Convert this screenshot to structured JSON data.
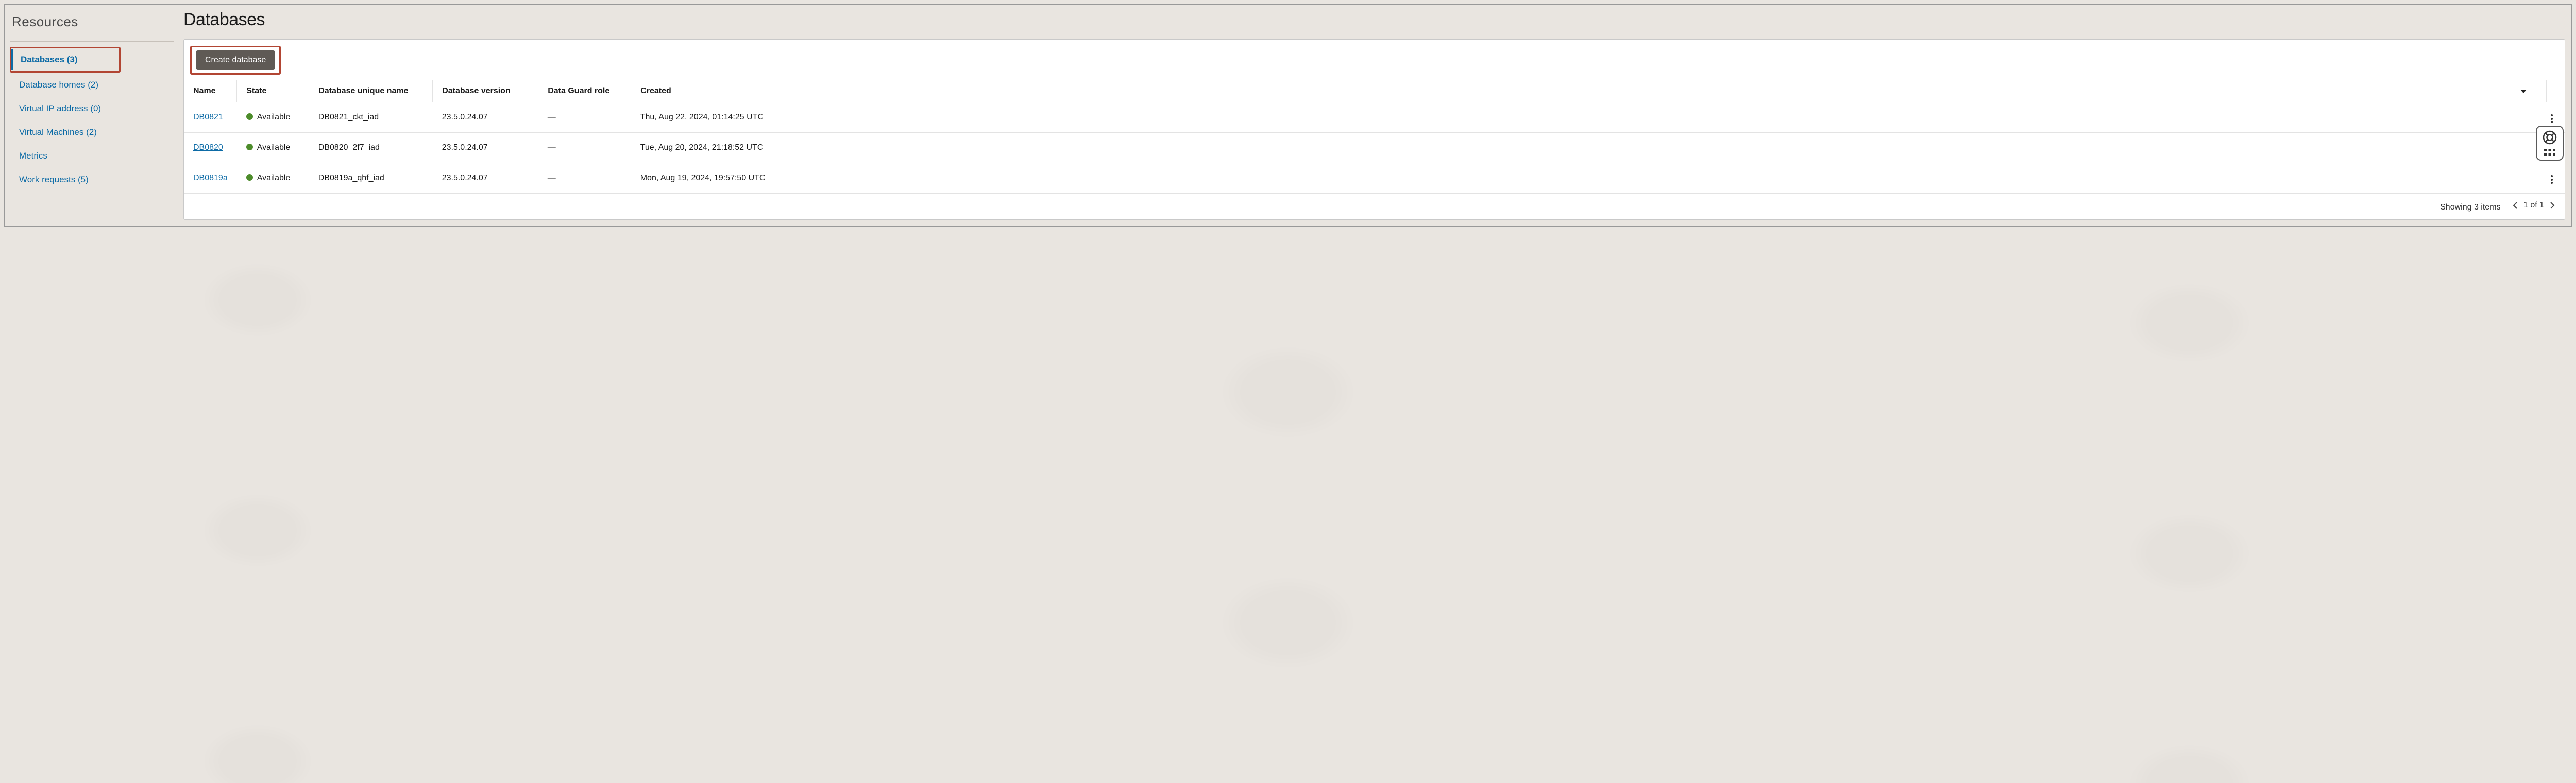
{
  "sidebar": {
    "title": "Resources",
    "items": [
      {
        "label": "Databases (3)",
        "active": true,
        "highlighted": true
      },
      {
        "label": "Database homes (2)",
        "active": false
      },
      {
        "label": "Virtual IP address (0)",
        "active": false
      },
      {
        "label": "Virtual Machines (2)",
        "active": false
      },
      {
        "label": "Metrics",
        "active": false
      },
      {
        "label": "Work requests (5)",
        "active": false
      }
    ]
  },
  "main": {
    "title": "Databases",
    "create_button": "Create database",
    "columns": {
      "name": "Name",
      "state": "State",
      "unique_name": "Database unique name",
      "version": "Database version",
      "dg_role": "Data Guard role",
      "created": "Created"
    },
    "rows": [
      {
        "name": "DB0821",
        "state": "Available",
        "status_color": "#4d8c2b",
        "unique_name": "DB0821_ckt_iad",
        "version": "23.5.0.24.07",
        "dg_role": "—",
        "created": "Thu, Aug 22, 2024, 01:14:25 UTC"
      },
      {
        "name": "DB0820",
        "state": "Available",
        "status_color": "#4d8c2b",
        "unique_name": "DB0820_2f7_iad",
        "version": "23.5.0.24.07",
        "dg_role": "—",
        "created": "Tue, Aug 20, 2024, 21:18:52 UTC"
      },
      {
        "name": "DB0819a",
        "state": "Available",
        "status_color": "#4d8c2b",
        "unique_name": "DB0819a_qhf_iad",
        "version": "23.5.0.24.07",
        "dg_role": "—",
        "created": "Mon, Aug 19, 2024, 19:57:50 UTC"
      }
    ],
    "footer": {
      "showing": "Showing 3 items",
      "page": "1 of 1"
    }
  }
}
